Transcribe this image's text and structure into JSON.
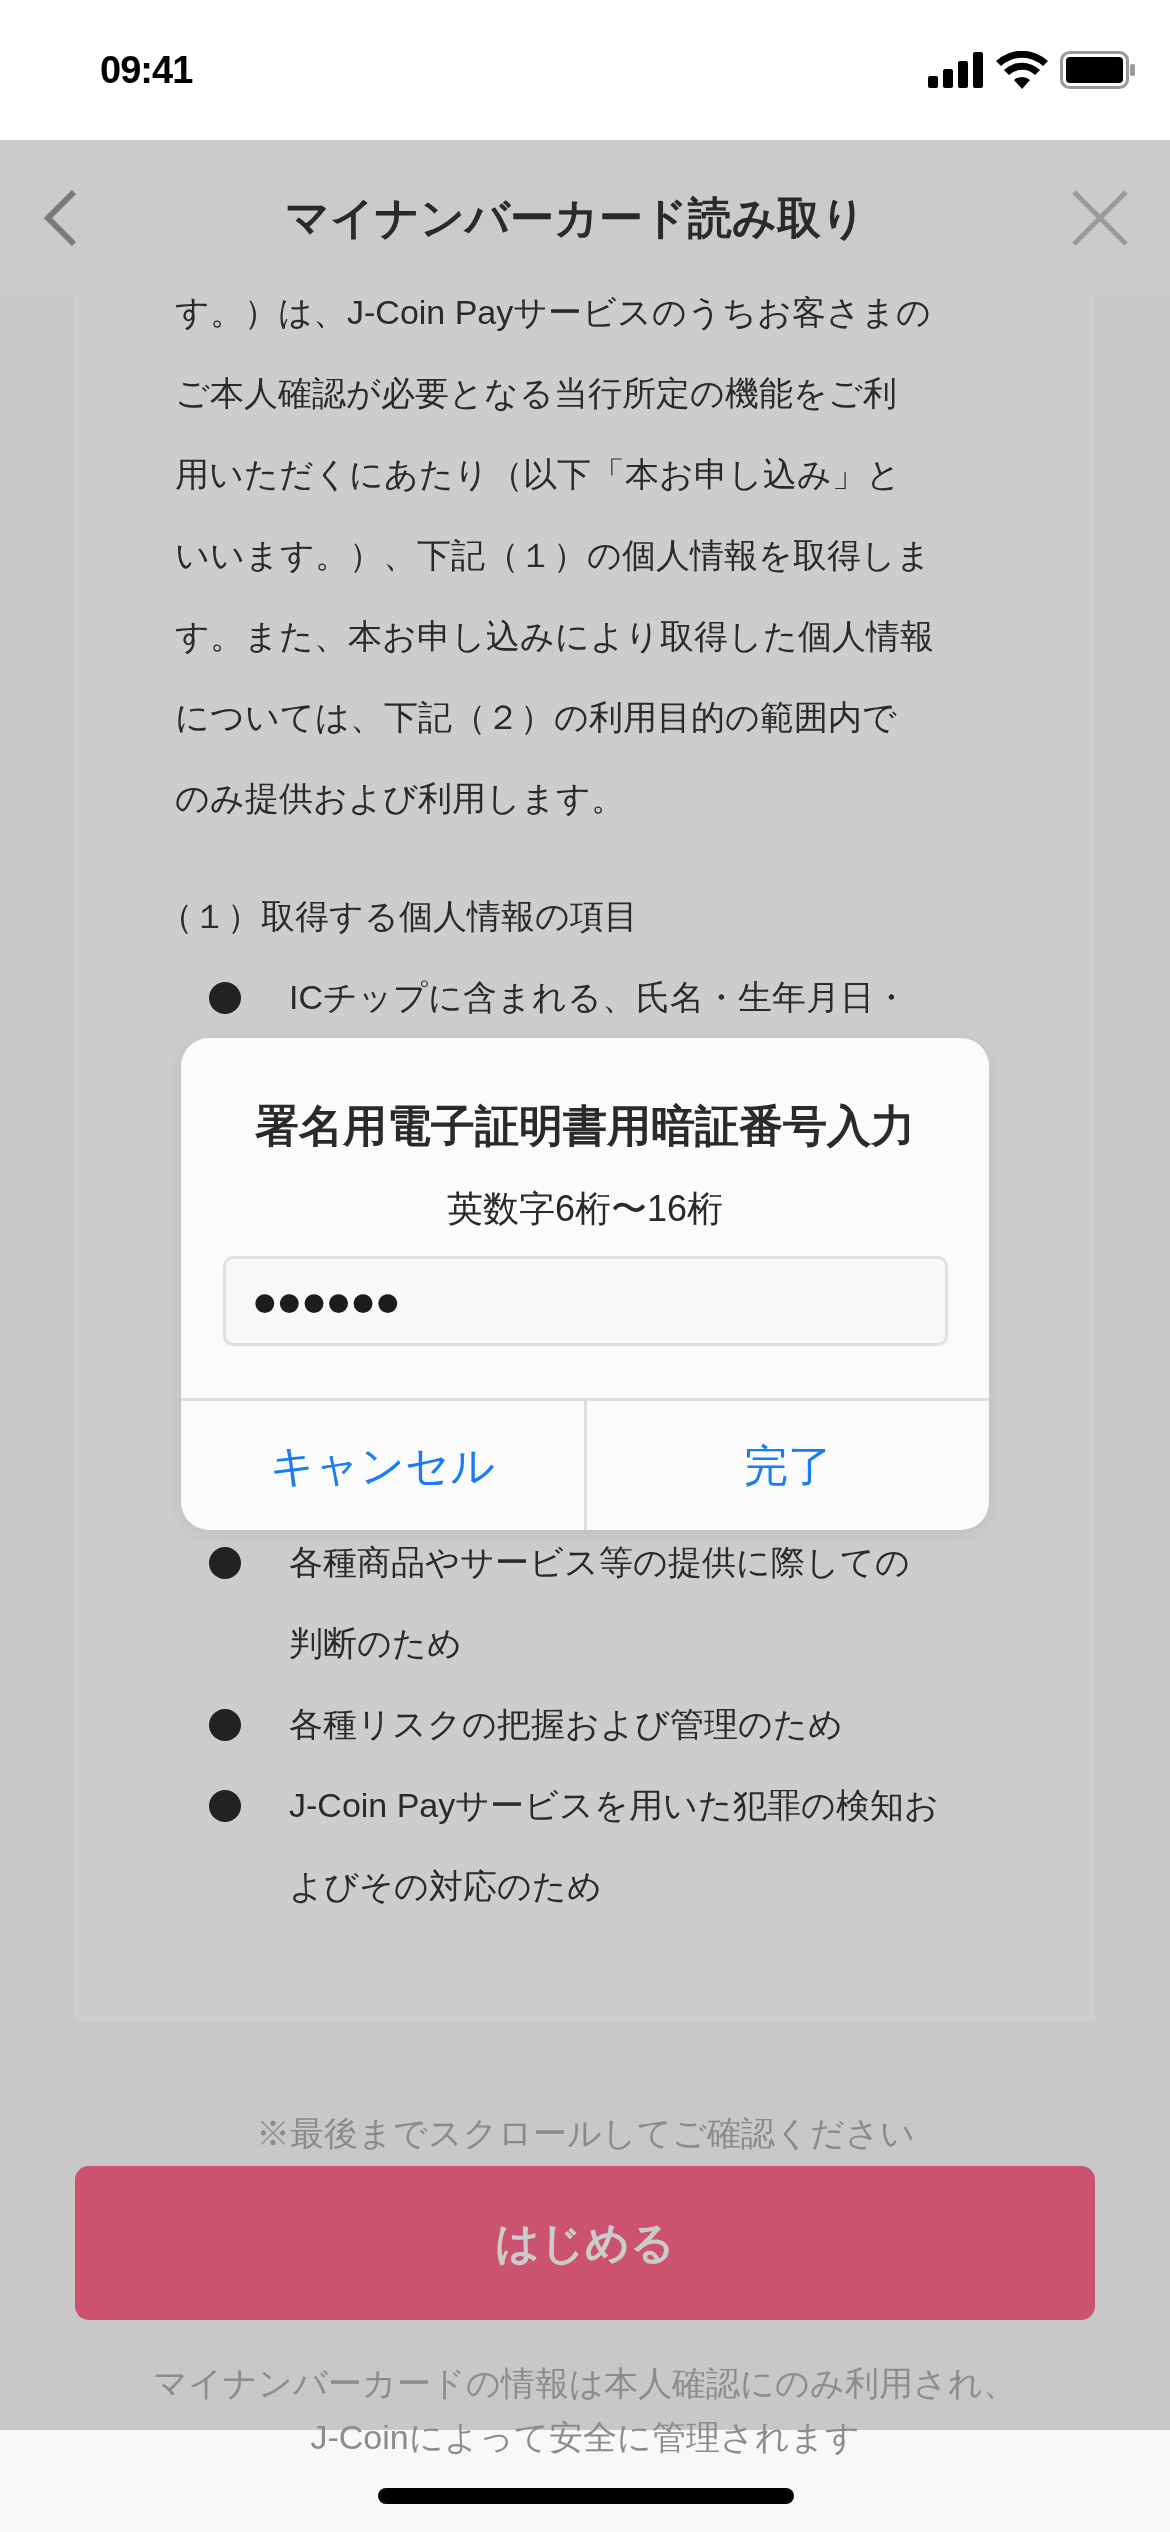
{
  "status_bar": {
    "time": "09:41"
  },
  "header": {
    "title": "マイナンバーカード読み取り"
  },
  "content": {
    "paragraph_lines": [
      "す。）は、J-Coin Payサービスのうちお客さまの",
      "ご本人確認が必要となる当行所定の機能をご利",
      "用いただくにあたり（以下「本お申し込み」と",
      "いいます。）、下記（１）の個人情報を取得しま",
      "す。また、本お申し込みにより取得した個人情報",
      "については、下記（２）の利用目的の範囲内で",
      "のみ提供および利用します。"
    ],
    "section_heading": "（１）取得する個人情報の項目",
    "items_before": [
      {
        "lines": [
          "ICチップに含まれる、氏名・生年月日・"
        ]
      }
    ],
    "items_after": [
      {
        "lines": [
          "各種商品やサービス等の提供に際しての",
          "判断のため"
        ]
      },
      {
        "lines": [
          "各種リスクの把握および管理のため"
        ]
      },
      {
        "lines": [
          "J-Coin Payサービスを用いた犯罪の検知お",
          "よびその対応のため"
        ]
      }
    ]
  },
  "scroll_note": "※最後までスクロールしてご確認ください",
  "start_button": {
    "label": "はじめる"
  },
  "footer_lines": [
    "マイナンバーカードの情報は本人確認にのみ利用され、",
    "J-Coinによって安全に管理されます"
  ],
  "dialog": {
    "title": "署名用電子証明書用暗証番号入力",
    "subtitle": "英数字6桁〜16桁",
    "input": {
      "value": "●●●●●●"
    },
    "buttons": [
      "キャンセル",
      "完了"
    ]
  }
}
